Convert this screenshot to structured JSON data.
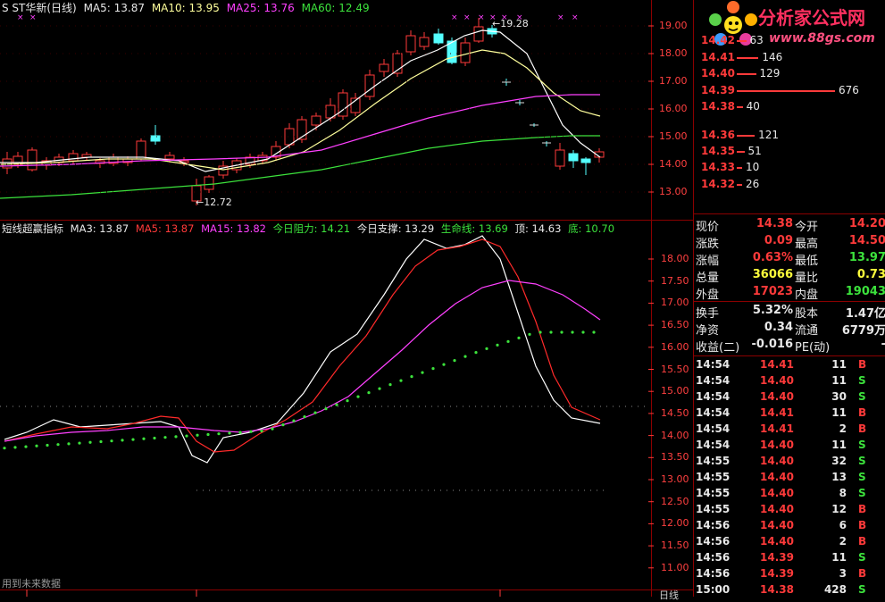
{
  "main_chart": {
    "title": "S ST华新(日线)",
    "ma5": "MA5: 13.87",
    "ma10": "MA10: 13.95",
    "ma25": "MA25: 13.76",
    "ma60": "MA60: 12.49",
    "high_label": "19.28",
    "low_label": "12.72",
    "price_axis": [
      "19.00",
      "18.00",
      "17.00",
      "16.00",
      "15.00",
      "14.00",
      "13.00"
    ]
  },
  "indicator": {
    "name": "短线超赢指标",
    "ma3": "MA3: 13.87",
    "ma5": "MA5: 13.87",
    "ma15": "MA15: 13.82",
    "resist": "今日阻力: 14.21",
    "support": "今日支撑: 13.29",
    "lifeline": "生命线: 13.69",
    "top": "顶: 14.63",
    "bottom": "底: 10.70",
    "axis": [
      "18.00",
      "17.50",
      "17.00",
      "16.50",
      "16.00",
      "15.50",
      "15.00",
      "14.50",
      "14.00",
      "13.50",
      "13.00",
      "12.50",
      "12.00",
      "11.50",
      "11.00"
    ]
  },
  "bottom_bar": {
    "future_data": "用到未来数据",
    "period": "日线"
  },
  "logo": {
    "title": "分析家公式网",
    "url": "www.88gs.com"
  },
  "order_book": [
    {
      "price": "14.42",
      "vol": "63"
    },
    {
      "price": "14.41",
      "vol": "146"
    },
    {
      "price": "14.40",
      "vol": "129"
    },
    {
      "price": "14.39",
      "vol": "676"
    },
    {
      "price": "14.38",
      "vol": "40"
    },
    {
      "price": "14.36",
      "vol": "121"
    },
    {
      "price": "14.35",
      "vol": "51"
    },
    {
      "price": "14.33",
      "vol": "10"
    },
    {
      "price": "14.32",
      "vol": "26"
    }
  ],
  "quote": {
    "r1": {
      "l1": "现价",
      "v1": "14.38",
      "l2": "今开",
      "v2": "14.20"
    },
    "r2": {
      "l1": "涨跌",
      "v1": "0.09",
      "l2": "最高",
      "v2": "14.50"
    },
    "r3": {
      "l1": "涨幅",
      "v1": "0.63%",
      "l2": "最低",
      "v2": "13.97"
    },
    "r4": {
      "l1": "总量",
      "v1": "36066",
      "l2": "量比",
      "v2": "0.73"
    },
    "r5": {
      "l1": "外盘",
      "v1": "17023",
      "l2": "内盘",
      "v2": "19043"
    },
    "r6": {
      "l1": "换手",
      "v1": "5.32%",
      "l2": "股本",
      "v2": "1.47亿"
    },
    "r7": {
      "l1": "净资",
      "v1": "0.34",
      "l2": "流通",
      "v2": "6779万"
    },
    "r8": {
      "l1": "收益(二)",
      "v1": "-0.016",
      "l2": "PE(动)",
      "v2": "-"
    }
  },
  "trades": [
    {
      "time": "14:54",
      "price": "14.41",
      "vol": "11",
      "side": "B"
    },
    {
      "time": "14:54",
      "price": "14.40",
      "vol": "11",
      "side": "S"
    },
    {
      "time": "14:54",
      "price": "14.40",
      "vol": "30",
      "side": "S"
    },
    {
      "time": "14:54",
      "price": "14.41",
      "vol": "11",
      "side": "B"
    },
    {
      "time": "14:54",
      "price": "14.41",
      "vol": "2",
      "side": "B"
    },
    {
      "time": "14:54",
      "price": "14.40",
      "vol": "11",
      "side": "S"
    },
    {
      "time": "14:55",
      "price": "14.40",
      "vol": "32",
      "side": "S"
    },
    {
      "time": "14:55",
      "price": "14.40",
      "vol": "13",
      "side": "S"
    },
    {
      "time": "14:55",
      "price": "14.40",
      "vol": "8",
      "side": "S"
    },
    {
      "time": "14:55",
      "price": "14.40",
      "vol": "12",
      "side": "B"
    },
    {
      "time": "14:56",
      "price": "14.40",
      "vol": "6",
      "side": "B"
    },
    {
      "time": "14:56",
      "price": "14.40",
      "vol": "2",
      "side": "B"
    },
    {
      "time": "14:56",
      "price": "14.39",
      "vol": "11",
      "side": "S"
    },
    {
      "time": "14:56",
      "price": "14.39",
      "vol": "3",
      "side": "B"
    },
    {
      "time": "15:00",
      "price": "14.38",
      "vol": "428",
      "side": "S"
    }
  ],
  "colors": {
    "up": "#ff3a3a",
    "down": "#54ffff",
    "ma5": "#ffffff",
    "ma10": "#ffff9c",
    "ma25": "#ff40ff",
    "ma60": "#3ce23c"
  }
}
